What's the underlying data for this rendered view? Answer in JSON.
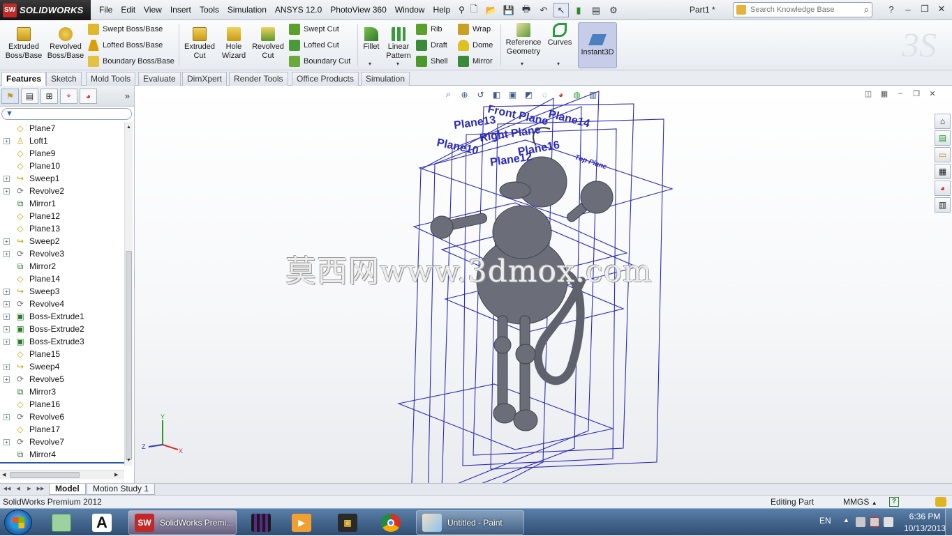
{
  "app": {
    "logo_text": "SOLIDWORKS",
    "document_title": "Part1 *"
  },
  "menus": [
    "File",
    "Edit",
    "View",
    "Insert",
    "Tools",
    "Simulation",
    "ANSYS 12.0",
    "PhotoView 360",
    "Window",
    "Help"
  ],
  "search": {
    "placeholder": "Search Knowledge Base"
  },
  "command_manager": {
    "extruded_boss": "Extruded\nBoss/Base",
    "revolved_boss": "Revolved\nBoss/Base",
    "swept_boss": "Swept Boss/Base",
    "lofted_boss": "Lofted Boss/Base",
    "boundary_boss": "Boundary Boss/Base",
    "extruded_cut": "Extruded\nCut",
    "hole_wizard": "Hole\nWizard",
    "revolved_cut": "Revolved\nCut",
    "swept_cut": "Swept Cut",
    "lofted_cut": "Lofted Cut",
    "boundary_cut": "Boundary Cut",
    "fillet": "Fillet",
    "linear_pattern": "Linear\nPattern",
    "rib": "Rib",
    "draft": "Draft",
    "shell": "Shell",
    "wrap": "Wrap",
    "dome": "Dome",
    "mirror": "Mirror",
    "reference_geometry": "Reference\nGeometry",
    "curves": "Curves",
    "instant3d": "Instant3D"
  },
  "tabs": [
    "Features",
    "Sketch",
    "Mold Tools",
    "Evaluate",
    "DimXpert",
    "Render Tools",
    "Office Products",
    "Simulation"
  ],
  "active_tab": "Features",
  "feature_tree": [
    {
      "label": "Plane7",
      "type": "plane",
      "expandable": false
    },
    {
      "label": "Loft1",
      "type": "loft",
      "expandable": true
    },
    {
      "label": "Plane9",
      "type": "plane",
      "expandable": false
    },
    {
      "label": "Plane10",
      "type": "plane",
      "expandable": false
    },
    {
      "label": "Sweep1",
      "type": "sweep",
      "expandable": true
    },
    {
      "label": "Revolve2",
      "type": "revolve",
      "expandable": true
    },
    {
      "label": "Mirror1",
      "type": "mirror",
      "expandable": false
    },
    {
      "label": "Plane12",
      "type": "plane",
      "expandable": false
    },
    {
      "label": "Plane13",
      "type": "plane",
      "expandable": false
    },
    {
      "label": "Sweep2",
      "type": "sweep",
      "expandable": true
    },
    {
      "label": "Revolve3",
      "type": "revolve",
      "expandable": true
    },
    {
      "label": "Mirror2",
      "type": "mirror",
      "expandable": false
    },
    {
      "label": "Plane14",
      "type": "plane",
      "expandable": false
    },
    {
      "label": "Sweep3",
      "type": "sweep",
      "expandable": true
    },
    {
      "label": "Revolve4",
      "type": "revolve",
      "expandable": true
    },
    {
      "label": "Boss-Extrude1",
      "type": "boss",
      "expandable": true
    },
    {
      "label": "Boss-Extrude2",
      "type": "boss",
      "expandable": true
    },
    {
      "label": "Boss-Extrude3",
      "type": "boss",
      "expandable": true
    },
    {
      "label": "Plane15",
      "type": "plane",
      "expandable": false
    },
    {
      "label": "Sweep4",
      "type": "sweep",
      "expandable": true
    },
    {
      "label": "Revolve5",
      "type": "revolve",
      "expandable": true
    },
    {
      "label": "Mirror3",
      "type": "mirror",
      "expandable": false
    },
    {
      "label": "Plane16",
      "type": "plane",
      "expandable": false
    },
    {
      "label": "Revolve6",
      "type": "revolve",
      "expandable": true
    },
    {
      "label": "Plane17",
      "type": "plane",
      "expandable": false
    },
    {
      "label": "Revolve7",
      "type": "revolve",
      "expandable": true
    },
    {
      "label": "Mirror4",
      "type": "mirror",
      "expandable": false
    }
  ],
  "viewport": {
    "watermark": "莫西网www.3dmox.com",
    "plane_labels": [
      "Front Plane",
      "Plane13",
      "Plane14",
      "Right Plane",
      "Plane16",
      "Plane10",
      "Plane12",
      "Top Plane"
    ],
    "triad": {
      "x": "X",
      "y": "Y",
      "z": "Z"
    },
    "colors": {
      "plane_edges": "#2a2ab8",
      "model_body": "#6b6e78",
      "triad_x": "#d03030",
      "triad_y": "#2a9a2a",
      "triad_z": "#2a3ab8"
    }
  },
  "bottom_tabs": [
    "Model",
    "Motion Study 1"
  ],
  "status": {
    "product": "SolidWorks Premium 2012",
    "mode": "Editing Part",
    "units": "MMGS",
    "units_arrow": "▲",
    "help": "?"
  },
  "taskbar": {
    "solidworks_label": "SolidWorks Premi...",
    "paint_label": "Untitled - Paint",
    "language": "EN",
    "time": "6:36 PM",
    "date": "10/13/2013"
  }
}
